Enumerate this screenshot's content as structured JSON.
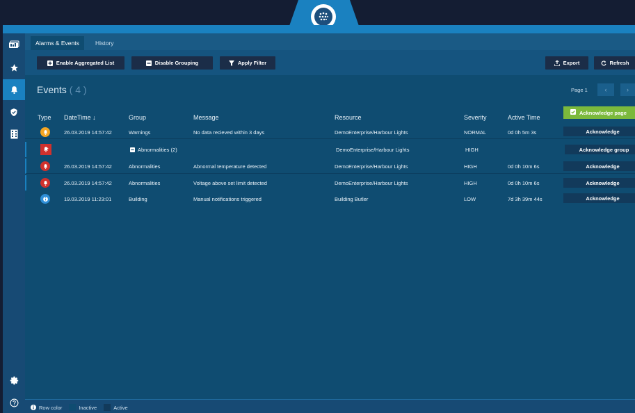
{
  "tabs": [
    {
      "label": "Alarms & Events",
      "active": true
    },
    {
      "label": "History",
      "active": false
    }
  ],
  "toolbar": {
    "enable_aggregated": "Enable Aggregated List",
    "disable_grouping": "Disable Grouping",
    "apply_filter": "Apply Filter",
    "export": "Export",
    "refresh": "Refresh"
  },
  "events": {
    "title": "Events",
    "count": "( 4 )",
    "page_label": "Page 1"
  },
  "table": {
    "columns": {
      "type": "Type",
      "datetime": "DateTime ↓",
      "group": "Group",
      "message": "Message",
      "resource": "Resource",
      "severity": "Severity",
      "active_time": "Active Time"
    },
    "acknowledge_page": "Acknowledge page",
    "rows": [
      {
        "icon": "warning-bell-icon",
        "datetime": "26.03.2019 14:57:42",
        "group": "Warnings",
        "message": "No data recieved within 3 days",
        "resource": "DemoEnterprise/Harbour Lights",
        "severity": "NORMAL",
        "active_time": "0d 0h 5m 3s",
        "action": "Acknowledge"
      },
      {
        "icon": "group-alarm-icon",
        "datetime": "",
        "group": "Abnormalities (2)",
        "message": "",
        "resource": "DemoEnterprise/Harbour Lights",
        "severity": "HIGH",
        "active_time": "",
        "action": "Acknowledge group"
      },
      {
        "icon": "alarm-bell-icon",
        "datetime": "26.03.2019 14:57:42",
        "group": "Abnormalities",
        "message": "Abnormal temperature detected",
        "resource": "DemoEnterprise/Harbour Lights",
        "severity": "HIGH",
        "active_time": "0d 0h 10m 6s",
        "action": "Acknowledge"
      },
      {
        "icon": "alarm-bell-icon",
        "datetime": "26.03.2019 14:57:42",
        "group": "Abnormalities",
        "message": "Voltage above set limit detected",
        "resource": "DemoEnterprise/Harbour Lights",
        "severity": "HIGH",
        "active_time": "0d 0h 10m 6s",
        "action": "Acknowledge"
      },
      {
        "icon": "info-icon",
        "datetime": "19.03.2019 11:23:01",
        "group": "Building",
        "message": "Manual notifications triggered",
        "resource": "Building Butler",
        "severity": "LOW",
        "active_time": "7d 3h 39m 44s",
        "action": "Acknowledge"
      }
    ]
  },
  "footer": {
    "row_color": "Row color",
    "inactive": "Inactive",
    "active": "Active"
  },
  "colors": {
    "accent": "#1a81c0",
    "warning": "#f5a623",
    "alarm": "#d0312d",
    "info": "#2f8fd8",
    "acknowledge_page": "#7bb93c"
  },
  "sidebar_icons": [
    "dashboard-icon",
    "star-icon",
    "bell-icon",
    "shield-icon",
    "building-icon",
    "settings-icon",
    "help-icon"
  ]
}
